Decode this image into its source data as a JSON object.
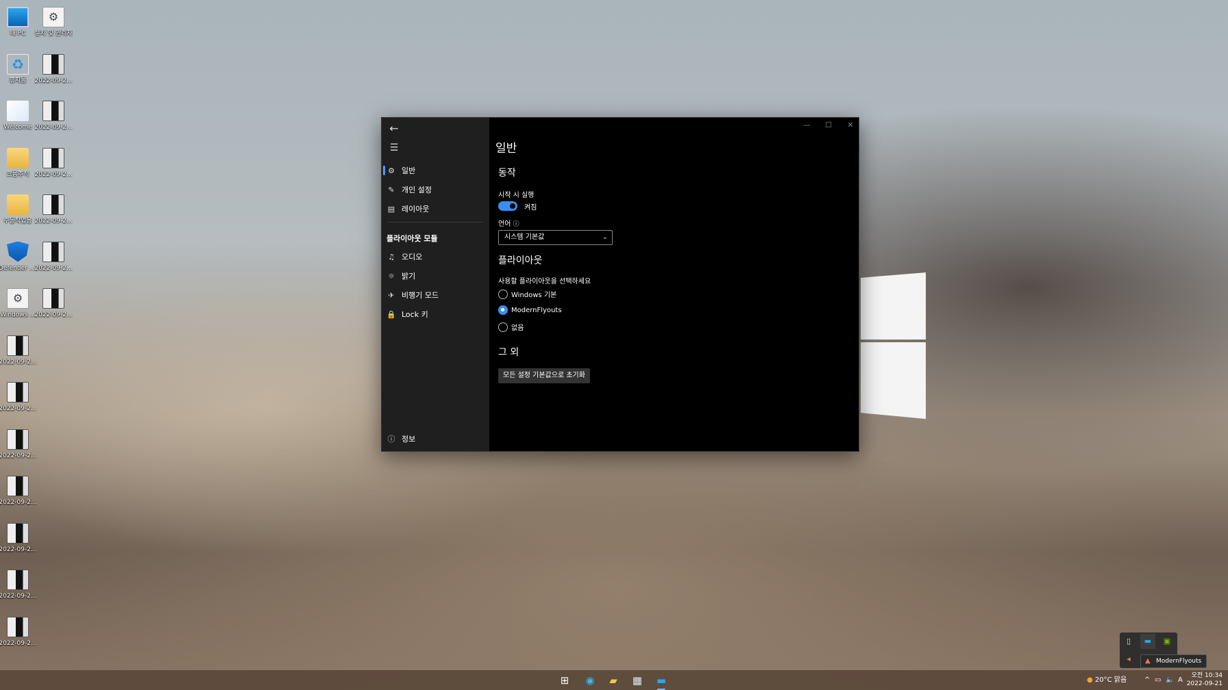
{
  "desktop": {
    "icons_left": [
      {
        "label": "내 PC",
        "type": "pc"
      },
      {
        "label": "휴지통",
        "type": "bin"
      },
      {
        "label": "Welcome",
        "type": "win"
      },
      {
        "label": "크롬추적",
        "type": "folder"
      },
      {
        "label": "수동작업용",
        "type": "folder"
      },
      {
        "label": "Defender Tools.exe",
        "type": "shield"
      },
      {
        "label": "Windows ...",
        "type": "gear"
      },
      {
        "label": "2022-09-2...",
        "type": "shot"
      },
      {
        "label": "2022-09-2...",
        "type": "shot"
      },
      {
        "label": "2022-09-2...",
        "type": "shot"
      },
      {
        "label": "2022-09-2...",
        "type": "shot"
      },
      {
        "label": "2022-09-2...",
        "type": "shot"
      },
      {
        "label": "2022-09-2...",
        "type": "shot"
      },
      {
        "label": "2022-09-2...",
        "type": "shot"
      }
    ],
    "icons_right": [
      {
        "label": "설치 및 관리자",
        "type": "gear"
      },
      {
        "label": "2022-09-2...",
        "type": "shot"
      },
      {
        "label": "2022-09-2...",
        "type": "shot"
      },
      {
        "label": "2022-09-2...",
        "type": "shot"
      },
      {
        "label": "2022-09-2...",
        "type": "shot"
      },
      {
        "label": "2022-09-2...",
        "type": "shot"
      },
      {
        "label": "2022-09-2...",
        "type": "shot"
      }
    ]
  },
  "window": {
    "controls": {
      "minimize": "—",
      "maximize": "☐",
      "close": "✕"
    },
    "nav": {
      "back_icon": "←",
      "menu_icon": "☰",
      "items": [
        {
          "label": "일반",
          "icon": "⚙",
          "active": true
        },
        {
          "label": "개인 설정",
          "icon": "✎",
          "active": false
        },
        {
          "label": "레이아웃",
          "icon": "▤",
          "active": false
        }
      ],
      "section_title": "플라이아웃 모듈",
      "modules": [
        {
          "label": "오디오",
          "icon": "♫"
        },
        {
          "label": "밝기",
          "icon": "☼"
        },
        {
          "label": "비행기 모드",
          "icon": "✈"
        },
        {
          "label": "Lock 키",
          "icon": "🔒"
        }
      ],
      "footer": {
        "label": "정보",
        "icon": "ⓘ"
      }
    },
    "content": {
      "title": "일반",
      "behavior": {
        "heading": "동작",
        "startup_label": "시작 시 실행",
        "startup_state": "켜짐",
        "language_label": "언어",
        "language_info_icon": "ⓘ",
        "language_value": "시스템 기본값",
        "language_chevron": "⌄"
      },
      "flyout": {
        "heading": "플라이아웃",
        "prompt": "사용할 플라이아웃을 선택하세요",
        "options": [
          {
            "label": "Windows 기본",
            "selected": false
          },
          {
            "label": "ModernFlyouts",
            "selected": true
          },
          {
            "label": "없음",
            "selected": false
          }
        ]
      },
      "other": {
        "heading": "그 외",
        "reset_button": "모든 설정 기본값으로 초기화"
      }
    }
  },
  "tray_flyout": {
    "tooltip": "ModernFlyouts"
  },
  "taskbar": {
    "weather": "20°C  맑음",
    "tray_chevron": "^",
    "ime": "A",
    "time": "오전 10:34",
    "date": "2022-09-21"
  }
}
